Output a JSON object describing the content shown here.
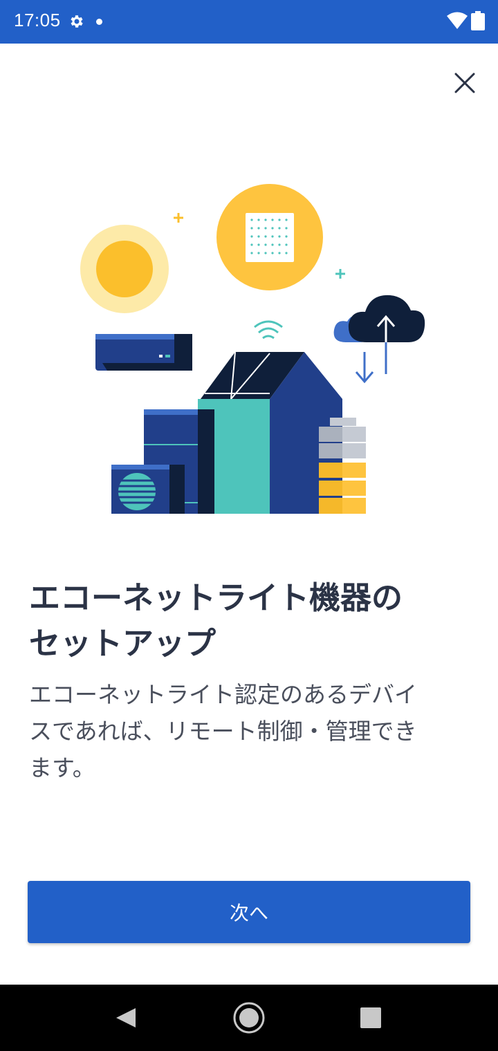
{
  "status_bar": {
    "time": "17:05",
    "icons": [
      "gear-icon",
      "notification-dot-icon",
      "wifi-icon",
      "battery-icon"
    ],
    "background_color": "#2260c8"
  },
  "header": {
    "close_icon": "close-icon"
  },
  "illustration": {
    "description_icon": "smart-home-devices-illustration"
  },
  "content": {
    "title_lines": [
      "エコーネットライト機器の",
      "セットアップ"
    ],
    "description_lines": [
      "エコーネットライト認定のあるデバイ",
      "スであれば、リモート制御・管理でき",
      "ます。"
    ]
  },
  "actions": {
    "next_label": "次へ",
    "accent_color": "#2260c8"
  },
  "nav_bar": {
    "icons": [
      "back-icon",
      "home-icon",
      "recents-icon"
    ]
  }
}
